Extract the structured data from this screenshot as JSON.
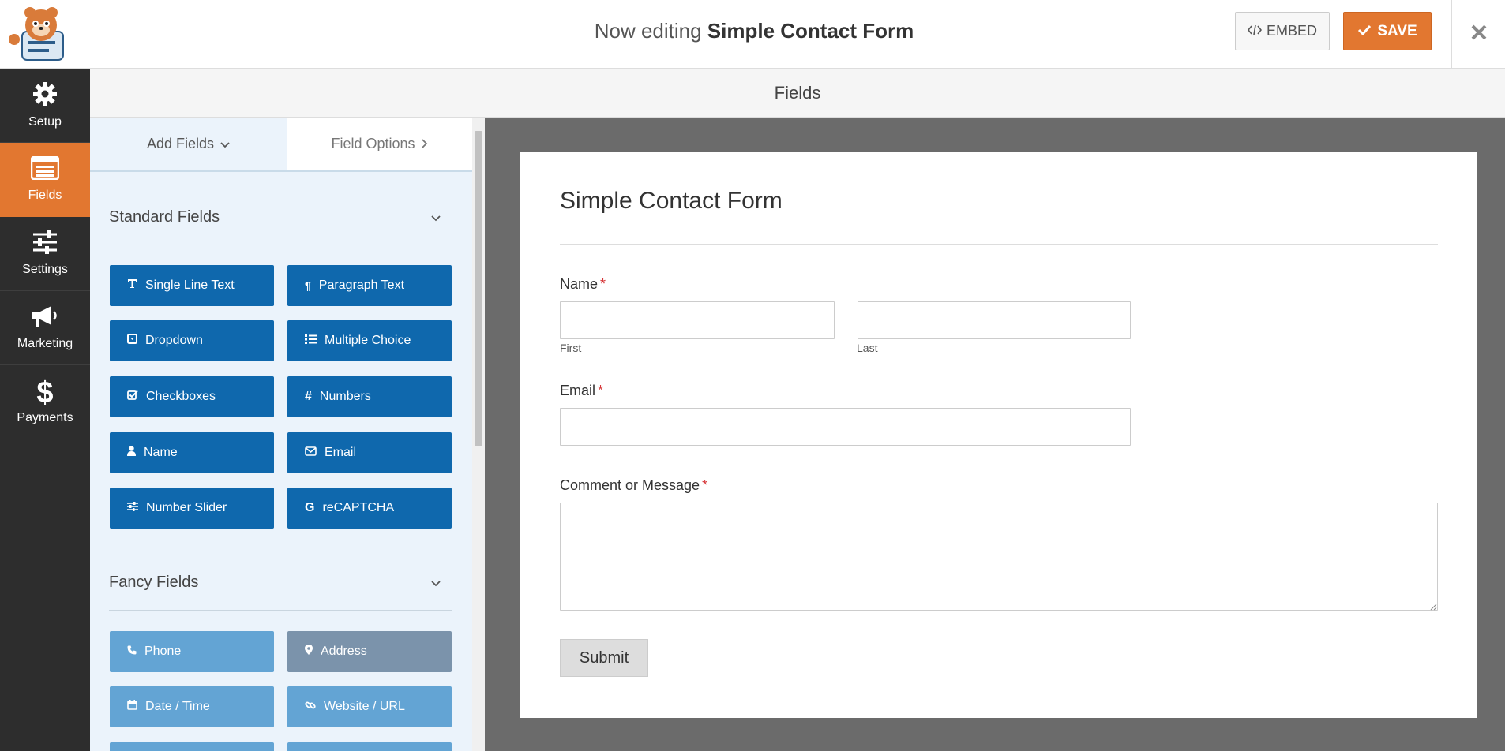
{
  "header": {
    "title_prefix": "Now editing",
    "form_name": "Simple Contact Form",
    "embed_label": "EMBED",
    "save_label": "SAVE"
  },
  "sidenav": {
    "items": [
      {
        "label": "Setup",
        "icon": "gear-icon"
      },
      {
        "label": "Fields",
        "icon": "fields-list-icon",
        "active": true
      },
      {
        "label": "Settings",
        "icon": "sliders-icon"
      },
      {
        "label": "Marketing",
        "icon": "megaphone-icon"
      },
      {
        "label": "Payments",
        "icon": "dollar-icon"
      }
    ]
  },
  "fields_header": "Fields",
  "panel": {
    "tabs": {
      "add_fields": "Add Fields",
      "field_options": "Field Options"
    },
    "standard_section": "Standard Fields",
    "standard_fields": [
      {
        "label": "Single Line Text",
        "icon": "text-icon"
      },
      {
        "label": "Paragraph Text",
        "icon": "paragraph-icon"
      },
      {
        "label": "Dropdown",
        "icon": "dropdown-icon"
      },
      {
        "label": "Multiple Choice",
        "icon": "list-icon"
      },
      {
        "label": "Checkboxes",
        "icon": "checkbox-icon"
      },
      {
        "label": "Numbers",
        "icon": "hash-icon"
      },
      {
        "label": "Name",
        "icon": "user-icon"
      },
      {
        "label": "Email",
        "icon": "envelope-icon"
      },
      {
        "label": "Number Slider",
        "icon": "sliders-icon"
      },
      {
        "label": "reCAPTCHA",
        "icon": "google-icon"
      }
    ],
    "fancy_section": "Fancy Fields",
    "fancy_fields": [
      {
        "label": "Phone",
        "icon": "phone-icon"
      },
      {
        "label": "Address",
        "icon": "map-marker-icon"
      },
      {
        "label": "Date / Time",
        "icon": "calendar-icon"
      },
      {
        "label": "Website / URL",
        "icon": "link-icon"
      }
    ]
  },
  "form": {
    "title": "Simple Contact Form",
    "name_label": "Name",
    "name_first": "First",
    "name_last": "Last",
    "email_label": "Email",
    "message_label": "Comment or Message",
    "required_mark": "*",
    "submit_label": "Submit"
  },
  "colors": {
    "accent": "#e27730",
    "sidebar": "#2d2d2d",
    "field_button": "#0f68ad",
    "fancy_button": "#63a4d4",
    "preview_bg": "#6b6b6b"
  }
}
